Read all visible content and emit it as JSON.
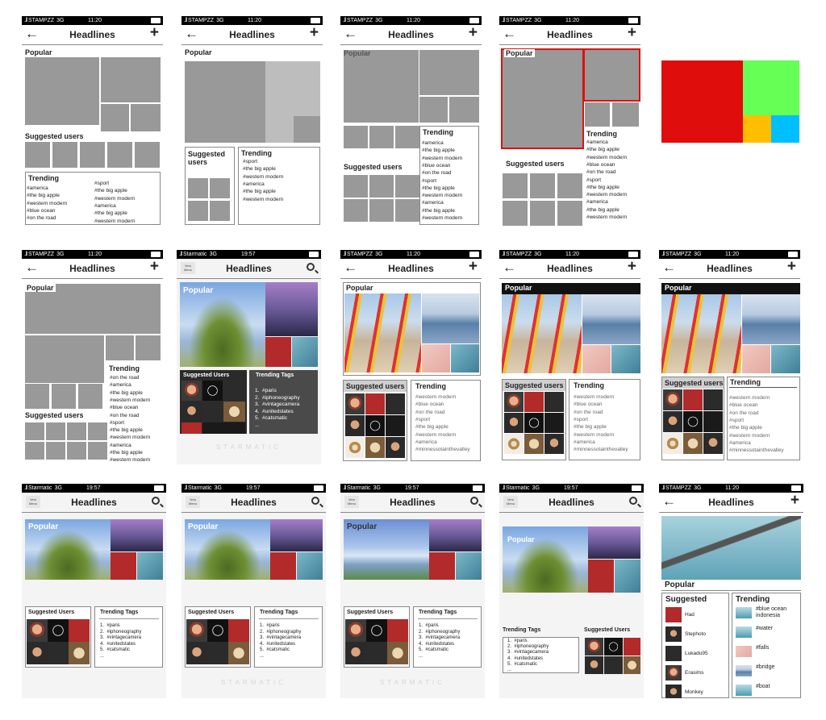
{
  "status": {
    "carrier_a": "STAMPZZ",
    "carrier_b": "Starmatic",
    "net": "3G",
    "time_a": "11:20",
    "time_b": "19:57"
  },
  "nav": {
    "title": "Headlines",
    "back": "←",
    "add": "+",
    "menu_a": "Vers",
    "menu_b": "Menu"
  },
  "labels": {
    "popular": "Popular",
    "suggested_users": "Suggested users",
    "suggested_users_cap": "Suggested Users",
    "suggested": "Suggested",
    "users": "users",
    "trending": "Trending",
    "trending_tags": "Trending Tags",
    "starmatic": "STARMATIC"
  },
  "tags_a": [
    "#america",
    "#the big apple",
    "#western modern",
    "#blue ocean",
    "#on the road"
  ],
  "tags_b": [
    "#sport",
    "#the big apple",
    "#western modern",
    "#america",
    "#the big apple",
    "#western modern"
  ],
  "tags_c": [
    "#western modern",
    "#blue ocean",
    "#on the road",
    "#sport",
    "#western modern",
    "#america",
    "#the big apple",
    "#western modern"
  ],
  "tags_d": [
    "#america",
    "#the big apple",
    "#western modern",
    "#blue ocean",
    "#on the road",
    "#sport",
    "#the big apple",
    "#western modern",
    "#america",
    "#the big apple",
    "#western modern"
  ],
  "tags_e": [
    "#on the road",
    "#america",
    "#the big apple",
    "#western modern",
    "#blue ocean",
    "#on the road",
    "#sport",
    "#the big apple",
    "#western modern",
    "#america",
    "#the big apple",
    "#western modern"
  ],
  "tags_f": [
    "#western modern",
    "#blue ocean",
    "#on the road",
    "#sport",
    "#the big apple",
    "#western modern",
    "#america",
    "#minnessotainthevalley"
  ],
  "tags_g": [
    "#america",
    "#the big apple",
    "#western modern",
    "#blue ocean",
    "#on the road",
    "#sport",
    "#the big apple",
    "#western modern",
    "#america",
    "#the big apple",
    "#western modern"
  ],
  "numbered_tags": [
    "1.  #paris",
    "2.  #iphoneography",
    "3.  #vintagecamera",
    "4.  #unitedstates",
    "5.  #catsmatic",
    "..."
  ],
  "final_users": [
    "Had",
    "Stephoto",
    "Lukadu95",
    "Erasims",
    "Monkey"
  ],
  "final_tags": [
    "#blue ocean indonesia",
    "#water",
    "#falls",
    "#bridge",
    "#boat"
  ],
  "colors": {
    "red": "#e00d0d",
    "green": "#66ff55",
    "yellow": "#ffbf00",
    "blue": "#00bfff",
    "placeholder": "#999999"
  }
}
